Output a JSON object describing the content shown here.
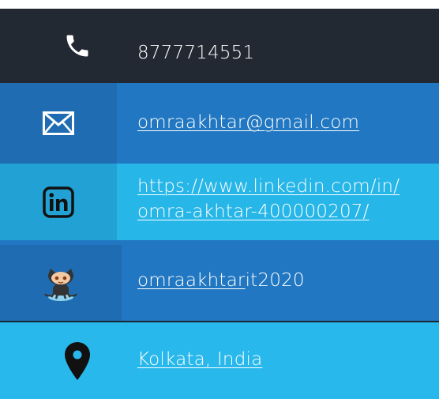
{
  "contact": {
    "phone": {
      "icon": "phone-icon",
      "number": "8777714551"
    },
    "email": {
      "icon": "email-icon",
      "address": "omraakhtar@gmail.com"
    },
    "linkedin": {
      "icon": "linkedin-icon",
      "url_line1": "https://www.linkedin.com/in/",
      "url_line2": "omra-akhtar-400000207/"
    },
    "github": {
      "icon": "github-octocat-icon",
      "user_link": "omraakhtar",
      "user_suffix": "it2020"
    },
    "location": {
      "icon": "map-pin-icon",
      "text": "Kolkata, India"
    }
  },
  "colors": {
    "dark": "#222933",
    "blue": "#2177c1",
    "blue_icon": "#1f6cb2",
    "cyan": "#27b6e8",
    "cyan_icon": "#22a2d4",
    "white": "#ffffff"
  }
}
